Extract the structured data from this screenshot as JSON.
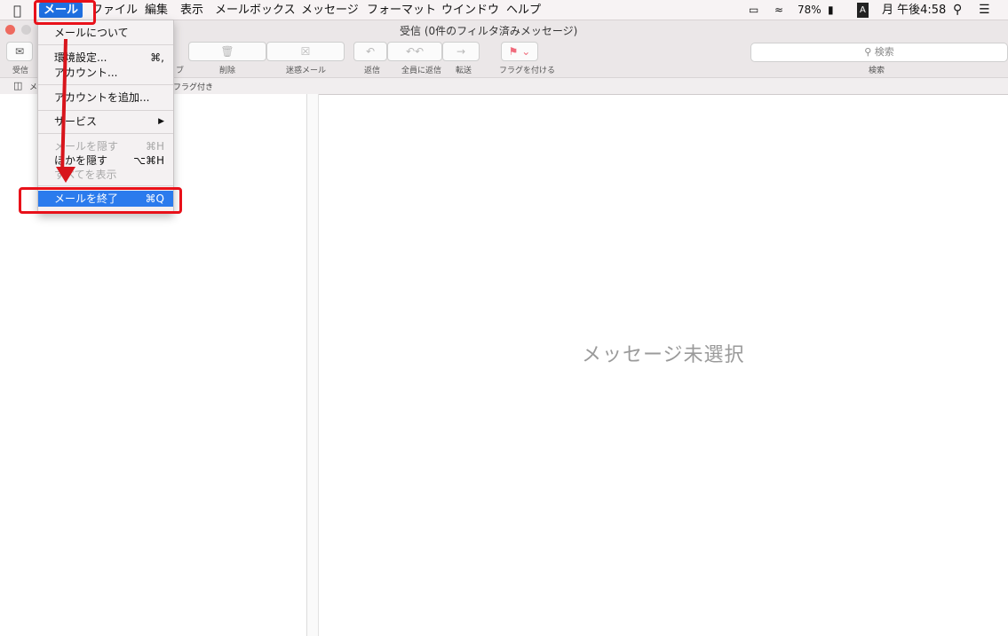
{
  "menubar": {
    "apple": "",
    "items": [
      "メール",
      "ファイル",
      "編集",
      "表示",
      "メールボックス",
      "メッセージ",
      "フォーマット",
      "ウインドウ",
      "ヘルプ"
    ],
    "battery": "78%",
    "input": "A",
    "clock": "月 午後4:58"
  },
  "window": {
    "title": "受信 (0件のフィルタ済みメッセージ)"
  },
  "toolbar": {
    "inbox_label": "受信",
    "archive_label": "ブ",
    "delete_label": "削除",
    "junk_label": "迷惑メール",
    "reply_label": "返信",
    "reply_all_label": "全員に返信",
    "forward_label": "転送",
    "flag_label": "フラグを付ける",
    "search_placeholder": "検索",
    "search_label": "検索"
  },
  "favbar": {
    "mailbox_label": "メ",
    "flagged_label": "フラグ付き"
  },
  "viewer": {
    "no_selection": "メッセージ未選択"
  },
  "mail_menu": {
    "items": [
      {
        "label": "メールについて",
        "shortcut": ""
      },
      {
        "label": "環境設定...",
        "shortcut": "⌘,"
      },
      {
        "label": "アカウント...",
        "shortcut": ""
      },
      {
        "label": "アカウントを追加...",
        "shortcut": ""
      },
      {
        "label": "サービス",
        "shortcut": "▶"
      },
      {
        "label": "メールを隠す",
        "shortcut": "⌘H"
      },
      {
        "label": "ほかを隠す",
        "shortcut": "⌥⌘H"
      },
      {
        "label": "すべてを表示",
        "shortcut": ""
      },
      {
        "label": "メールを終了",
        "shortcut": "⌘Q"
      }
    ]
  },
  "colors": {
    "menu_highlight": "#2b7bed",
    "annotation": "#e8111a"
  }
}
